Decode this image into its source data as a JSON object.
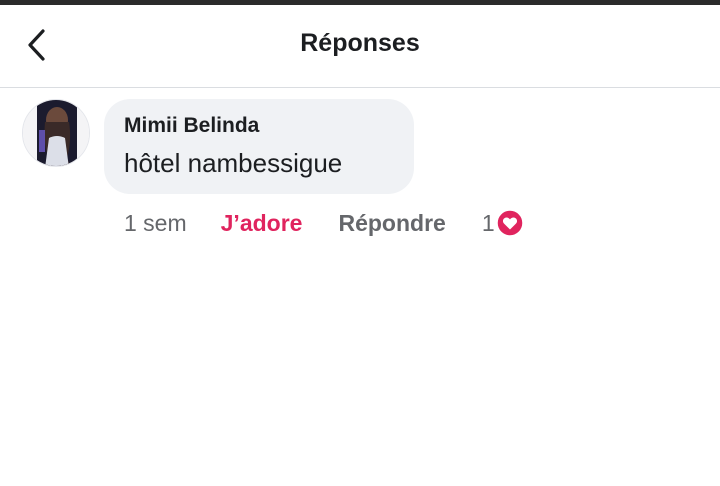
{
  "header": {
    "title": "Réponses",
    "back_icon": "chevron-left-icon"
  },
  "comment": {
    "author": "Mimii Belinda",
    "text": "hôtel nambessigue",
    "timestamp": "1 sem",
    "reaction_label": "J’adore",
    "reply_label": "Répondre",
    "reaction_count": "1",
    "reaction_icon": "heart-icon"
  },
  "colors": {
    "reaction": "#e0245e",
    "bubble": "#f0f2f5",
    "secondary_text": "#65676b"
  }
}
